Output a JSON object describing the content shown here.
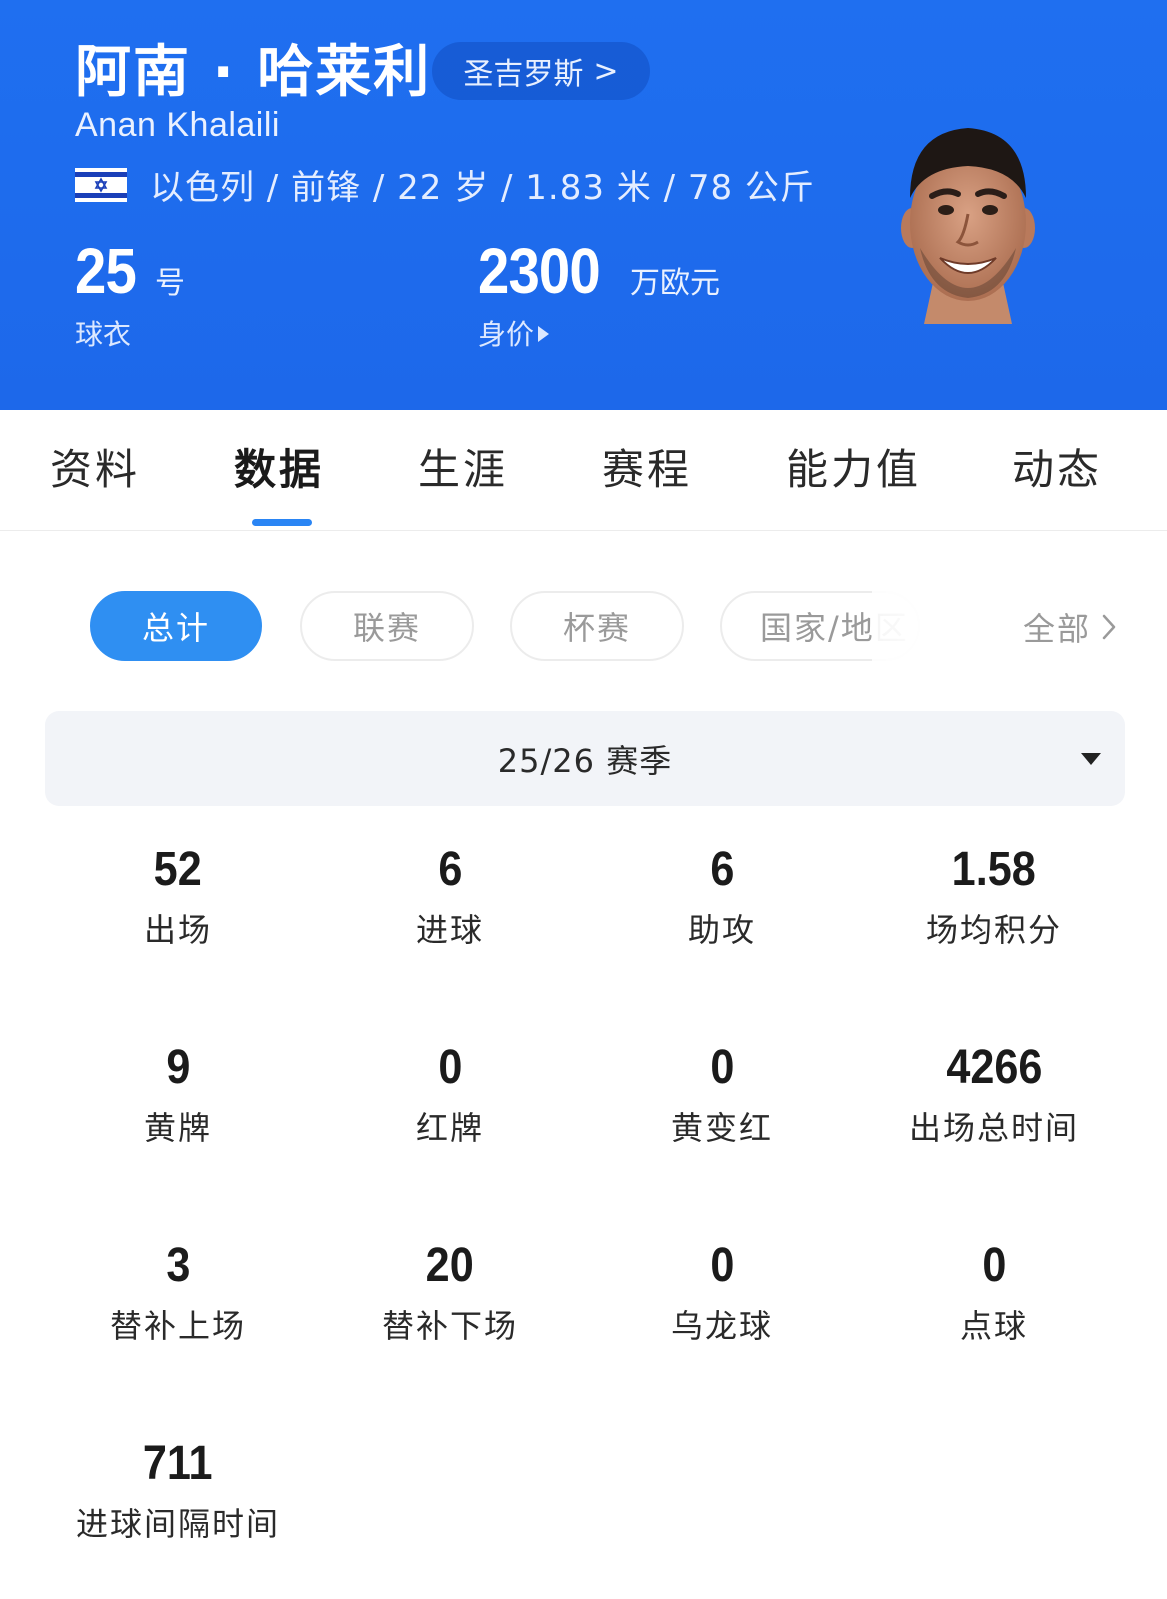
{
  "player": {
    "name_cn": "阿南 · 哈莱利",
    "club": "圣吉罗斯",
    "club_chevron": ">",
    "name_en": "Anan Khalaili",
    "meta": "以色列 / 前锋 / 22 岁 / 1.83 米 / 78 公斤",
    "shirt_number": "25",
    "shirt_unit": "号",
    "shirt_label": "球衣",
    "market_value": "2300",
    "market_value_unit": "万欧元",
    "market_value_label": "身价"
  },
  "tabs": [
    {
      "label": "资料"
    },
    {
      "label": "数据",
      "active": true
    },
    {
      "label": "生涯"
    },
    {
      "label": "赛程"
    },
    {
      "label": "能力值"
    },
    {
      "label": "动态"
    }
  ],
  "filters": [
    {
      "label": "总计",
      "active": true
    },
    {
      "label": "联赛"
    },
    {
      "label": "杯赛"
    },
    {
      "label": "国家/地区"
    }
  ],
  "all_label": "全部",
  "season": "25/26 赛季",
  "stats": [
    {
      "value": "52",
      "label": "出场"
    },
    {
      "value": "6",
      "label": "进球"
    },
    {
      "value": "6",
      "label": "助攻"
    },
    {
      "value": "1.58",
      "label": "场均积分"
    },
    {
      "value": "9",
      "label": "黄牌"
    },
    {
      "value": "0",
      "label": "红牌"
    },
    {
      "value": "0",
      "label": "黄变红"
    },
    {
      "value": "4266",
      "label": "出场总时间"
    },
    {
      "value": "3",
      "label": "替补上场"
    },
    {
      "value": "20",
      "label": "替补下场"
    },
    {
      "value": "0",
      "label": "乌龙球"
    },
    {
      "value": "0",
      "label": "点球"
    },
    {
      "value": "711",
      "label": "进球间隔时间"
    }
  ],
  "colors": {
    "header_bg": "#1f6ff0",
    "accent": "#2f8ff2",
    "season_bg": "#f2f4f8"
  }
}
